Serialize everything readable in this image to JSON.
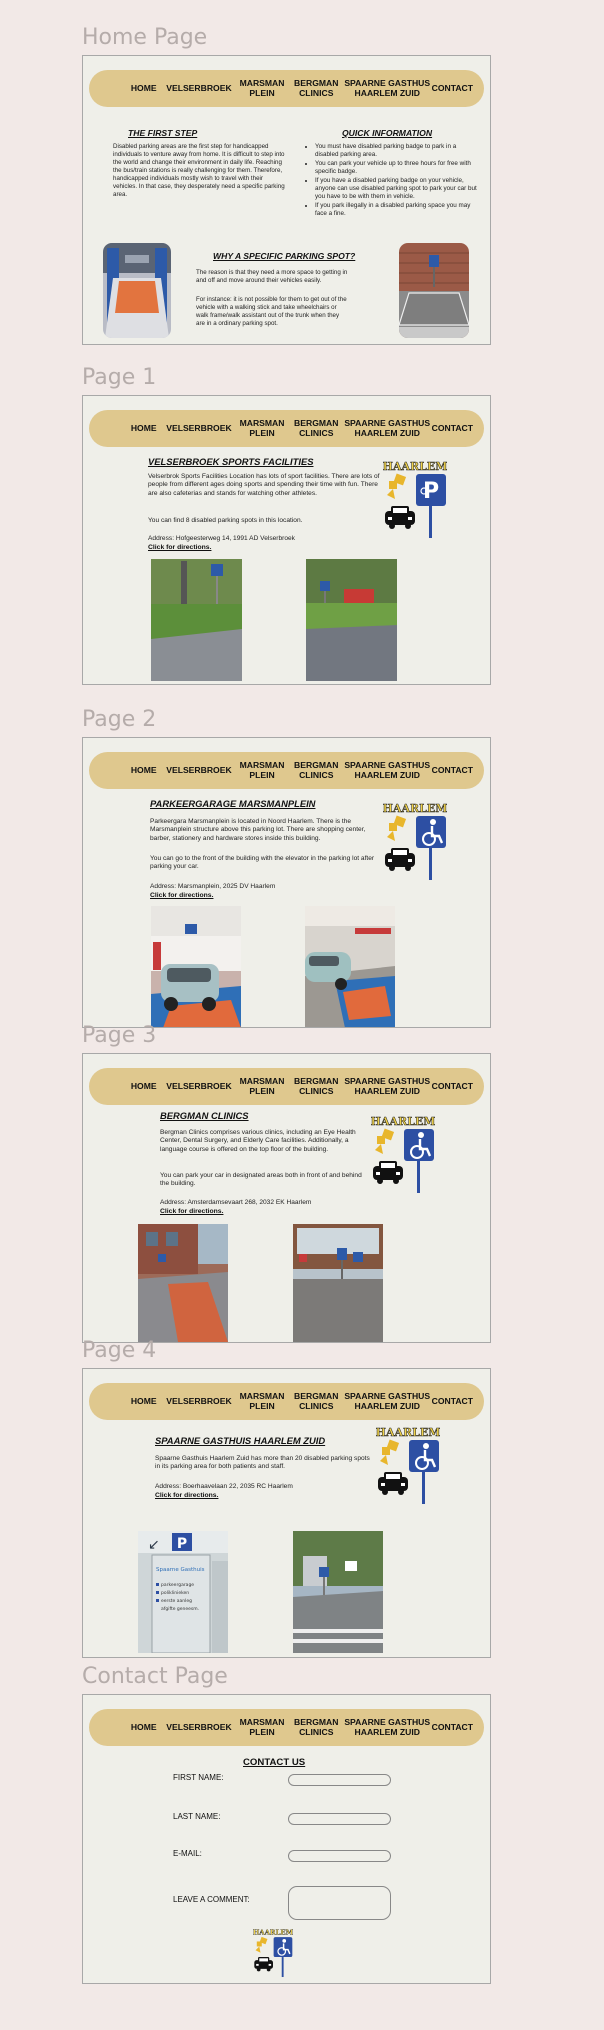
{
  "colors": {
    "nav": "#dfc88e",
    "frame": "#efefe9",
    "background": "#f2e9e7",
    "logo_yellow": "#e8b62c",
    "logo_blue": "#2d4fa3"
  },
  "nav": {
    "home": "HOME",
    "velserbroek": "VELSERBROEK",
    "marsman": "MARSMAN PLEIN",
    "bergman": "BERGMAN CLINICS",
    "spaarne": "SPAARNE GASTHUS HAARLEM ZUID",
    "contact": "CONTACT"
  },
  "logo": {
    "word": "HAARLEM",
    "icons": [
      "parking-p-icon",
      "wheelchair-icon",
      "car-icon",
      "arrow-icon"
    ]
  },
  "home": {
    "label": "Home Page",
    "first_step_title": "THE FIRST STEP",
    "first_step_text": "Disabled parking areas are the first step for handicapped individuals to venture away from home. It is difficult to step into the world and change their environment in daily life. Reaching the bus/train stations is really challenging for them. Therefore, handicapped individuals mostly wish to travel with their vehicles. In that case, they desperately need a specific parking area.",
    "quick_title": "QUICK INFORMATION",
    "quick_items": [
      "You must have disabled parking badge to park in a disabled parking area.",
      "You can park your vehicle up to three hours for free with specific badge.",
      "If you have a disabled parking badge on your vehicle, anyone can use disabled parking spot to park your car but you have to be with them in vehicle.",
      "If you park illegally in a disabled parking space you may face a fine."
    ],
    "why_title": "WHY A SPECIFIC PARKING SPOT?",
    "why_text_1": "The reason is that they need a more space to getting in and off and move around their vehicles easily.",
    "why_text_2": "For instance: it is not possible for them to get out of the vehicle with a walking stick and take wheelchairs or walk frame/walk assistant out of the trunk when they are in a ordinary parking spot."
  },
  "page1": {
    "label": "Page 1",
    "title": "VELSERBROEK SPORTS FACILITIES",
    "text_1": "Velserbrok Sports Facilities Location has lots of sport facilities. There are lots of people from different ages doing sports and spending their time with fun. There are also cafeterias and stands for watching other athletes.",
    "text_2": "You can find 8 disabled parking spots in this location.",
    "address": "Address: Hofgeesterweg 14, 1991 AD Velserbroek",
    "directions": "Click for directions."
  },
  "page2": {
    "label": "Page 2",
    "title": "PARKEERGARAGE MARSMANPLEIN",
    "text_1": "Parkeergara Marsmanplein is located in Noord Haarlem. There is the Marsmanplein structure above this parking lot. There are shopping center, barber, stationery and hardware stores inside this building.",
    "text_2": "You can go to the front of the building with the elevator in the parking lot after parking your car.",
    "address": "Address: Marsmanplein, 2025 DV Haarlem",
    "directions": "Click for directions."
  },
  "page3": {
    "label": "Page 3",
    "title": "BERGMAN CLINICS",
    "text_1": "Bergman Clinics comprises various clinics, including an Eye Health Center, Dental Surgery, and Elderly Care facilities. Additionally, a language course is offered on the top floor of the building.",
    "text_2": "You can park your car in designated areas both in front of and behind the building.",
    "address": "Address: Amsterdamsevaart 268, 2032 EK Haarlem",
    "directions": "Click for directions."
  },
  "page4": {
    "label": "Page 4",
    "title": "SPAARNE GASTHUIS HAARLEM ZUID",
    "text_1": "Spaarne Gasthuis Haarlem Zuid has more than 20 disabled parking spots in its parking area for both patients and staff.",
    "address": "Address: Boerhaavelaan 22, 2035 RC Haarlem",
    "directions": "Click for directions.",
    "sign_lines": [
      "parkeergarage",
      "Spaarne Gasthuis",
      "poliklinieken",
      "eerste aanleg",
      "afgifte geneesm."
    ]
  },
  "contact": {
    "label": "Contact Page",
    "title": "CONTACT US",
    "first_name": "FIRST NAME:",
    "last_name": "LAST NAME:",
    "email": "E-MAIL:",
    "comment": "LEAVE A COMMENT:"
  }
}
